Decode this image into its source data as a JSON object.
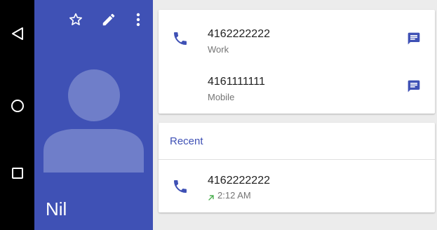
{
  "nav": {
    "back_icon": "back-triangle-icon",
    "home_icon": "home-circle-icon",
    "recents_icon": "recents-square-icon"
  },
  "contact": {
    "name": "Nil",
    "header_color": "#3f51b5",
    "actions": {
      "favorite_icon": "star-outline-icon",
      "edit_icon": "pencil-icon",
      "more_icon": "more-vert-icon"
    }
  },
  "numbers": [
    {
      "number": "4162222222",
      "type": "Work"
    },
    {
      "number": "4161111111",
      "type": "Mobile"
    }
  ],
  "recent": {
    "title": "Recent",
    "items": [
      {
        "number": "4162222222",
        "time": "2:12 AM",
        "direction": "outgoing"
      }
    ]
  },
  "colors": {
    "accent": "#3f51b5",
    "outgoing": "#4caf50"
  }
}
